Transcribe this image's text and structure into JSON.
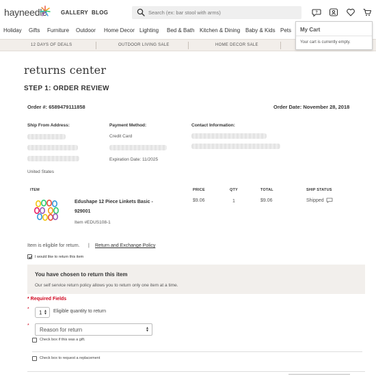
{
  "header": {
    "logo": "hayneedle",
    "nav": [
      "GALLERY",
      "BLOG"
    ],
    "search_placeholder": "Search (ex: bar stool with arms)"
  },
  "categories": [
    "Holiday",
    "Gifts",
    "Furniture",
    "Outdoor",
    "Home Decor",
    "Lighting",
    "Bed & Bath",
    "Kitchen & Dining",
    "Baby & Kids",
    "Pets"
  ],
  "promos": [
    "12 DAYS OF DEALS",
    "OUTDOOR LIVING SALE",
    "HOME DECOR SALE"
  ],
  "cart": {
    "title": "My Cart",
    "message": "Your cart is currently empty."
  },
  "page": {
    "title": "returns center",
    "step": "STEP 1: ORDER REVIEW"
  },
  "order": {
    "number_label": "Order #: 6589479111858",
    "date_label": "Order Date: November 28, 2018",
    "ship_from_label": "Ship From Address:",
    "country": "United States",
    "payment_label": "Payment Method:",
    "payment_type": "Credit Card",
    "expiration": "Expiration Date: 11/2025",
    "contact_label": "Contact Information:"
  },
  "table": {
    "headers": {
      "item": "ITEM",
      "price": "PRICE",
      "qty": "QTY",
      "total": "TOTAL",
      "status": "SHIP STATUS"
    },
    "row": {
      "name_line1": "Edushape 12 Piece Linkets Basic -",
      "name_line2": "929001",
      "item_no": "Item #EDUS108-1",
      "price": "$9.06",
      "qty": "1",
      "total": "$9.06",
      "status": "Shipped"
    }
  },
  "eligibility": {
    "text": "Item is eligible for return.",
    "sep": "|",
    "link": "Return and Exchange Policy"
  },
  "return_checkbox": "I would like to return this item",
  "notice": {
    "title": "You have chosen to return this item",
    "body": "Our self service return policy allows you to return only one item at a time."
  },
  "form": {
    "required": "* Required Fields",
    "star": "*",
    "qty_value": "1",
    "qty_label": "Eligible quantity to return",
    "reason_value": "Reason for return",
    "gift_label": "Check box if this was a gift.",
    "replacement_label": "Check box to request a replacement"
  },
  "colors": {
    "promo_bg": "#f2eeea",
    "notice_bg": "#f2efec",
    "required_red": "#d0021b"
  }
}
